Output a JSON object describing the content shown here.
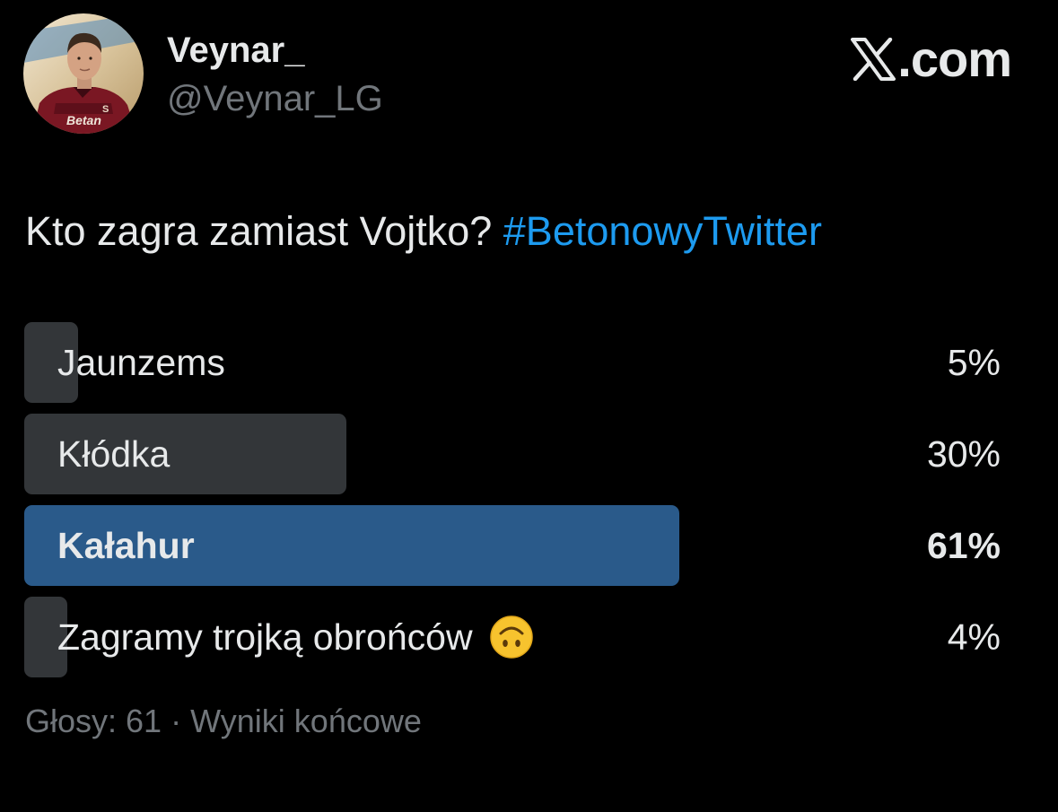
{
  "author": {
    "display_name": "Veynar_",
    "handle": "@Veynar_LG",
    "avatar_shirt_text": "Betan"
  },
  "brand": {
    "icon": "x-logo-icon",
    "text": ".com"
  },
  "tweet": {
    "text": "Kto zagra zamiast Vojtko? ",
    "hashtag": "#BetonowyTwitter"
  },
  "poll": {
    "options": [
      {
        "label": "Jaunzems",
        "percent_text": "5%",
        "percent": 5,
        "winner": false
      },
      {
        "label": "Kłódka",
        "percent_text": "30%",
        "percent": 30,
        "winner": false
      },
      {
        "label": "Kałahur",
        "percent_text": "61%",
        "percent": 61,
        "winner": true
      },
      {
        "label": "Zagramy trojką obrońców",
        "percent_text": "4%",
        "percent": 4,
        "winner": false,
        "emoji": "upside-down-face-icon"
      }
    ],
    "votes_label": "Głosy: 61",
    "separator": "·",
    "status_label": "Wyniki końcowe"
  },
  "colors": {
    "background": "#000000",
    "text": "#e7e9ea",
    "muted": "#71767b",
    "hashtag": "#1d9bf0",
    "bar": "#333639",
    "bar_winner": "#2a5a8a"
  }
}
